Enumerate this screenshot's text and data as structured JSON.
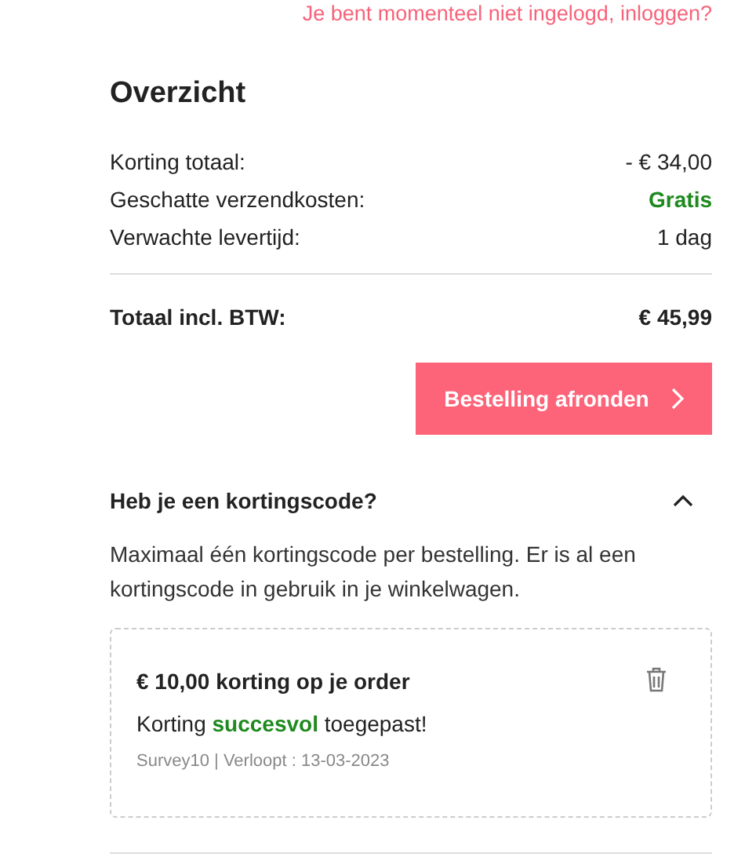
{
  "login_link": "Je bent momenteel niet ingelogd, inloggen?",
  "title": "Overzicht",
  "summary_rows": [
    {
      "label": "Korting totaal:",
      "value": "- € 34,00",
      "highlight": false
    },
    {
      "label": "Geschatte verzendkosten:",
      "value": "Gratis",
      "highlight": true
    },
    {
      "label": "Verwachte levertijd:",
      "value": "1 dag",
      "highlight": false
    }
  ],
  "total": {
    "label": "Totaal incl. BTW:",
    "value": "€ 45,99"
  },
  "checkout_button": {
    "label": "Bestelling afronden"
  },
  "discount_section": {
    "title": "Heb je een kortingscode?",
    "expanded": true,
    "description": "Maximaal één kortingscode per bestelling. Er is al een kortingscode in gebruik in je winkelwagen.",
    "applied_code": {
      "title": "€ 10,00 korting op je order",
      "message": "Korting **succesvol** toegepast!",
      "details": "Survey10 | Verloopt : 13-03-2023"
    }
  }
}
